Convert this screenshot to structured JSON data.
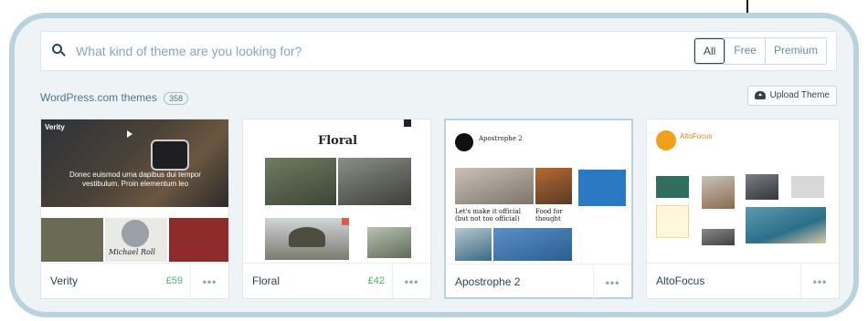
{
  "search": {
    "placeholder": "What kind of theme are you looking for?"
  },
  "filters": [
    {
      "label": "All",
      "active": true
    },
    {
      "label": "Free",
      "active": false
    },
    {
      "label": "Premium",
      "active": false
    }
  ],
  "section": {
    "title": "WordPress.com themes",
    "count": "358"
  },
  "upload_button": "Upload Theme",
  "themes": [
    {
      "name": "Verity",
      "price": "£59",
      "preview": {
        "logo": "Verity",
        "hero_text": "Donec euismod urna dapibus dui tempor vestibulum. Proin elementum leo",
        "signature": "Michael Roll"
      }
    },
    {
      "name": "Floral",
      "price": "£42",
      "preview": {
        "logo": "Floral"
      }
    },
    {
      "name": "Apostrophe 2",
      "price": "",
      "preview": {
        "logo": "Apostrophe 2",
        "post1": "Let's make it official (but not too official)",
        "post2": "Food for thought"
      }
    },
    {
      "name": "AltoFocus",
      "price": "",
      "preview": {
        "logo": "AltoFocus"
      }
    }
  ],
  "more_label": "•••",
  "colors": {
    "accent": "#4ab866",
    "frame": "#b9d3de",
    "text": "#2e4453"
  }
}
